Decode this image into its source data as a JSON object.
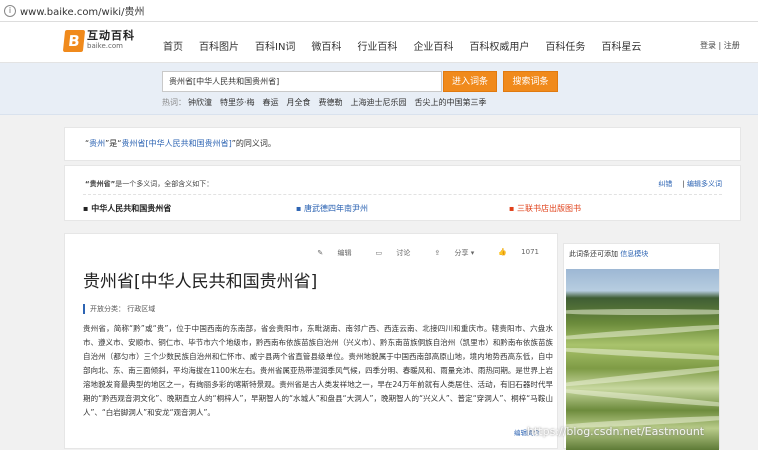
{
  "address_bar": {
    "url": "www.baike.com/wiki/贵州"
  },
  "nav": {
    "logo_text": "互动百科",
    "logo_sub": "baike.com",
    "logo_mark": "B",
    "menu": [
      "首页",
      "百科图片",
      "百科IN词",
      "微百科",
      "行业百科",
      "企业百科",
      "百科权威用户",
      "百科任务",
      "百科星云"
    ],
    "login": "登录",
    "register": "注册"
  },
  "search": {
    "value": "贵州省[中华人民共和国贵州省]",
    "enter_button": "进入词条",
    "search_button": "搜索词条",
    "hot_label": "热词：",
    "hot_terms": [
      "钟欣潼",
      "特里莎·梅",
      "春运",
      "月全食",
      "费德勒",
      "上海迪士尼乐园",
      "舌尖上的中国第三季"
    ]
  },
  "synonym": {
    "quote_open": "“",
    "term": "贵州",
    "mid": "”是“",
    "target": "贵州省[中华人民共和国贵州省]",
    "tail": "”的同义词。"
  },
  "polysemy": {
    "header_term": "“贵州省”",
    "header_text": "是一个多义词，全部含义如下：",
    "correct": "纠错",
    "edit": "编辑多义词",
    "options": [
      "中华人民共和国贵州省",
      "唐武德四年南尹州",
      "三联书店出版图书"
    ]
  },
  "article": {
    "tools": [
      "编辑",
      "讨论",
      "分享",
      "1071"
    ],
    "title": "贵州省[中华人民共和国贵州省]",
    "category": "开放分类：  行政区域",
    "body": "贵州省，简称“黔”或“贵”，位于中国西南的东南部，省会贵阳市，东毗湖南、南邻广西、西连云南、北接四川和重庆市。辖贵阳市、六盘水市、遵义市、安顺市、铜仁市、毕节市六个地级市，黔西南布依族苗族自治州（兴义市）、黔东南苗族侗族自治州（凯里市）和黔南布依族苗族自治州（都匀市）三个少数民族自治州和仁怀市、威宁县两个省直管县级单位。贵州地貌属于中国西南部高原山地，境内地势西高东低，自中部向北、东、南三面倾斜，平均海拔在1100米左右。贵州省属亚热带湿润季风气候，四季分明、春暖风和、雨量充沛、雨热同期。是世界上岩溶地貌发育最典型的地区之一，有绚丽多彩的喀斯特景观。贵州省是古人类发祥地之一，早在24万年前就有人类居住、活动，有旧石器时代早期的“黔西观音洞文化”、晚期直立人的“桐梓人”，早期智人的“水城人”和盘县“大洞人”，晚期智人的“兴义人”、普定“穿洞人”、桐梓“马鞍山人”、“白岩脚洞人”和安龙“观音洞人”。",
    "more": "编辑简介"
  },
  "sidebar": {
    "prompt": "此词条还可添加",
    "link": "信息模块"
  },
  "watermark": "https://blog.csdn.net/Eastmount"
}
